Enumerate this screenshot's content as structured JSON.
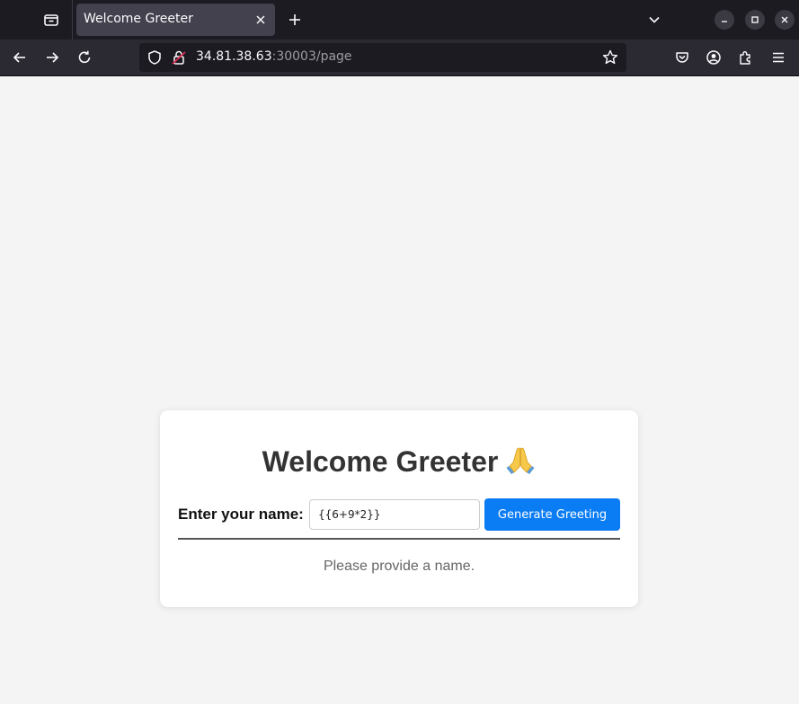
{
  "browser": {
    "tab": {
      "title": "Welcome Greeter"
    },
    "url": {
      "host": "34.81.38.63",
      "rest": ":30003/page"
    }
  },
  "page": {
    "title": "Welcome Greeter",
    "label": "Enter your name:",
    "name_input": {
      "value": "{{6+9*2}}"
    },
    "button_label": "Generate Greeting",
    "result_text": "Please provide a name."
  },
  "colors": {
    "accent": "#0a7cf4",
    "page_bg": "#f4f4f4",
    "card_bg": "#ffffff",
    "title": "#333333",
    "result": "#666666"
  },
  "icons": [
    "tab-list-icon",
    "close-icon",
    "plus-icon",
    "chevron-down-icon",
    "minimize-icon",
    "maximize-icon",
    "window-close-icon",
    "back-arrow-icon",
    "forward-arrow-icon",
    "reload-icon",
    "shield-icon",
    "lock-icon",
    "star-icon",
    "pocket-icon",
    "account-icon",
    "extensions-icon",
    "hamburger-menu-icon",
    "praying-hands-icon"
  ]
}
